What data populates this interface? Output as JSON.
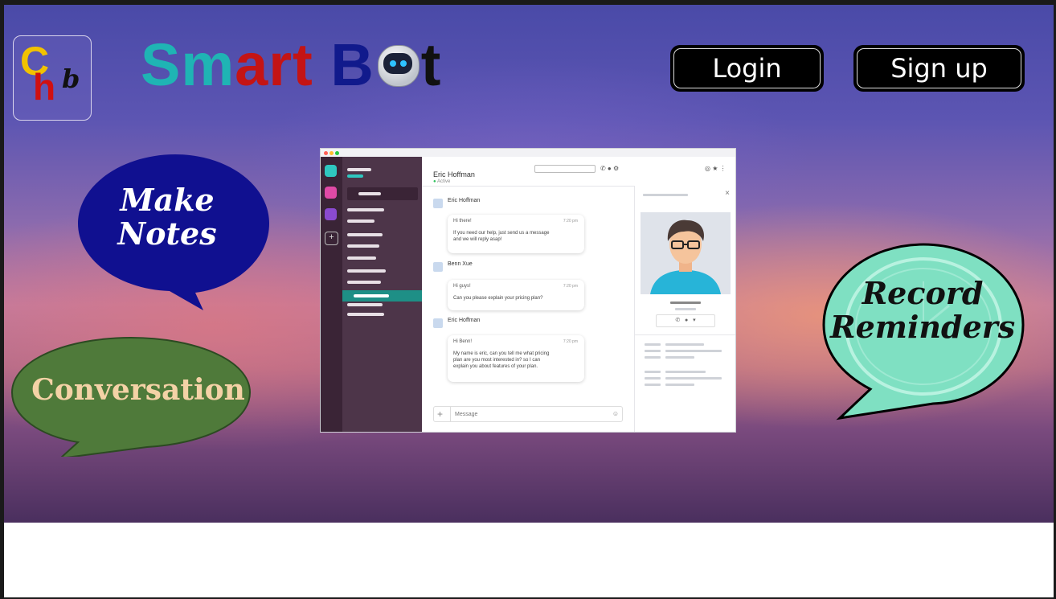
{
  "brand": {
    "logo_letters": [
      "C",
      "h",
      "b"
    ],
    "name_part1": "Sm",
    "name_part2": "art",
    "name_part3": "B",
    "name_part4": "t"
  },
  "auth": {
    "login_label": "Login",
    "signup_label": "Sign up"
  },
  "bubbles": {
    "notes": [
      "Make",
      "Notes"
    ],
    "conversation": "Conversation",
    "reminders": [
      "Record",
      "Reminders"
    ]
  },
  "colors": {
    "notes_bubble": "#101090",
    "conversation_bubble": "#4f7a3a",
    "reminders_bubble": "#7fe0c2",
    "chat_accent": "#1e8f86"
  },
  "app_preview": {
    "chat_title": "Eric Hoffman",
    "chat_status": "Active",
    "messages": [
      {
        "author": "Eric Hoffman",
        "greeting": "Hi there!",
        "time": "7:20 pm",
        "lines": [
          "If you need our help, just send us a message",
          "and we will reply asap!"
        ]
      },
      {
        "author": "Benn Xue",
        "greeting": "Hi guys!",
        "time": "7:20 pm",
        "lines": [
          "Can you please explain your pricing plan?"
        ]
      },
      {
        "author": "Eric Hoffman",
        "greeting": "Hi Benn!",
        "time": "7:20 pm",
        "lines": [
          "My name is eric, can you tell me what pricing",
          "plan are you most interested in? so I can",
          "explain you about features of your plan."
        ]
      }
    ],
    "composer_placeholder": "Message"
  }
}
